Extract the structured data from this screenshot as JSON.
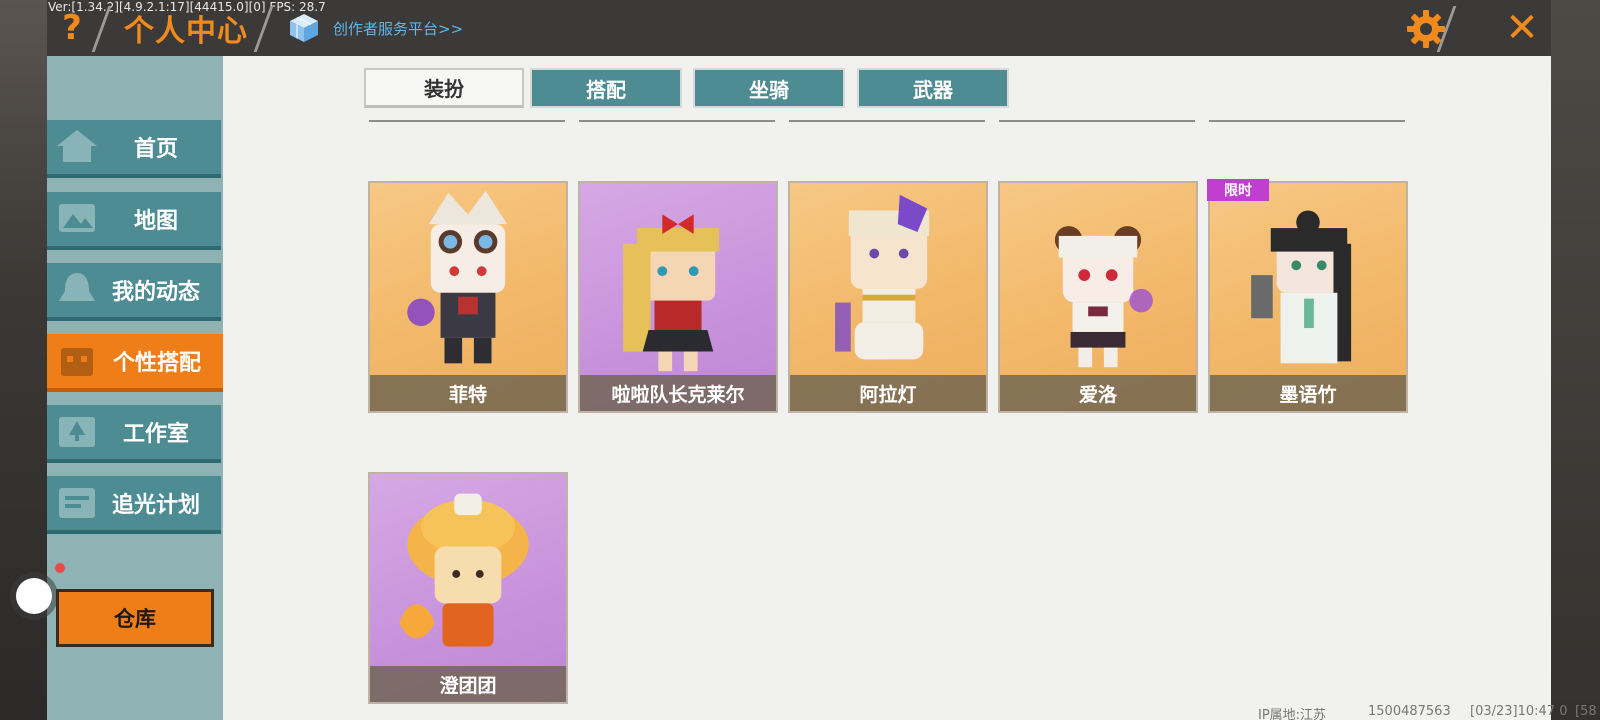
{
  "debug_overlay": "Ver:[1.34.2][4.9.2.1:17][44415.0][0] FPS: 28.7",
  "header": {
    "title": "个人中心",
    "creator_link": "创作者服务平台>>",
    "help_glyph": "?",
    "close_glyph": "✕",
    "accent_color": "#f08a1c"
  },
  "sidebar": {
    "items": [
      {
        "label": "首页",
        "icon": "home-icon",
        "active": false
      },
      {
        "label": "地图",
        "icon": "map-icon",
        "active": false
      },
      {
        "label": "我的动态",
        "icon": "bell-icon",
        "active": false
      },
      {
        "label": "个性搭配",
        "icon": "outfit-icon",
        "active": true
      },
      {
        "label": "工作室",
        "icon": "tree-icon",
        "active": false
      },
      {
        "label": "追光计划",
        "icon": "plan-icon",
        "active": false
      }
    ],
    "warehouse_label": "仓库"
  },
  "tabs": [
    {
      "label": "装扮",
      "active": true
    },
    {
      "label": "搭配",
      "active": false
    },
    {
      "label": "坐骑",
      "active": false
    },
    {
      "label": "武器",
      "active": false
    }
  ],
  "skins": [
    {
      "name": "菲特",
      "style": "gold"
    },
    {
      "name": "啦啦队长克莱尔",
      "style": "purple"
    },
    {
      "name": "阿拉灯",
      "style": "gold"
    },
    {
      "name": "爱洛",
      "style": "gold"
    },
    {
      "name": "墨语竹",
      "style": "gold",
      "badge": "限时"
    },
    {
      "name": "澄团团",
      "style": "purple"
    }
  ],
  "footer": {
    "ip_location": "IP属地:江苏",
    "user_id": "1500487563",
    "timestamp": "[03/23]10:47 0",
    "trailing": "[58"
  },
  "colors": {
    "sidebar_bg": "#8fb3b4",
    "nav_teal": "#4e8c93",
    "active_orange": "#f07e18",
    "badge_purple": "#c03fd0"
  }
}
